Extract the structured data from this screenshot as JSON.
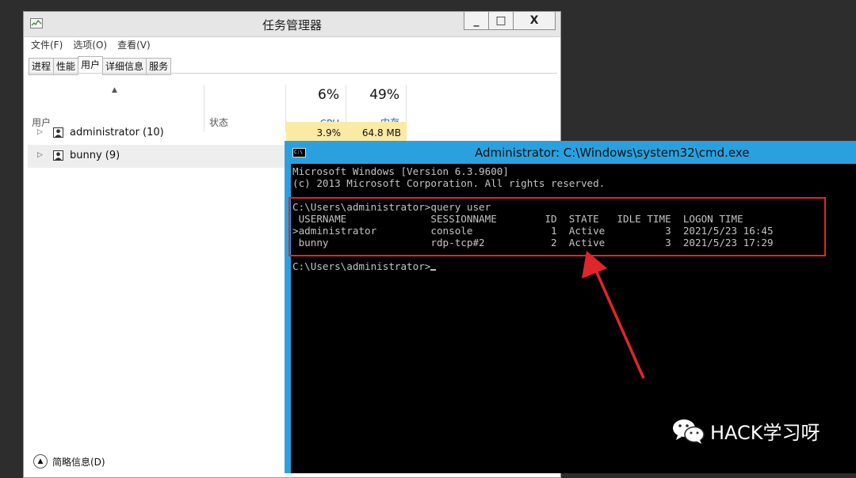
{
  "task_manager": {
    "title": "任务管理器",
    "window_buttons": [
      "_",
      "□",
      "X"
    ],
    "menu": [
      "文件(F)",
      "选项(O)",
      "查看(V)"
    ],
    "tabs": [
      "进程",
      "性能",
      "用户",
      "详细信息",
      "服务"
    ],
    "active_tab": "用户",
    "columns": {
      "user": "用户",
      "status": "状态",
      "cpu_percent": "6%",
      "cpu_label": "CPU",
      "mem_percent": "49%",
      "mem_label": "内存"
    },
    "rows": [
      {
        "name": "administrator (10)",
        "cpu": "3.9%",
        "memory": "64.8 MB"
      },
      {
        "name": "bunny (9)",
        "cpu": "",
        "memory": ""
      }
    ],
    "footer": "简略信息(D)"
  },
  "cmd": {
    "title": "Administrator: C:\\Windows\\system32\\cmd.exe",
    "icon_text": "C:\\",
    "lines_header": "Microsoft Windows [Version 6.3.9600]\n(c) 2013 Microsoft Corporation. All rights reserved.",
    "lines_query": "C:\\Users\\administrator>query user\n USERNAME              SESSIONNAME        ID  STATE   IDLE TIME  LOGON TIME\n>administrator         console             1  Active          3  2021/5/23 16:45\n bunny                 rdp-tcp#2           2  Active          3  2021/5/23 17:29",
    "prompt": "C:\\Users\\administrator>"
  },
  "annotation": {
    "color": "#e0262a"
  },
  "watermark": {
    "text": "HACK学习呀",
    "icon": "wechat-icon"
  }
}
